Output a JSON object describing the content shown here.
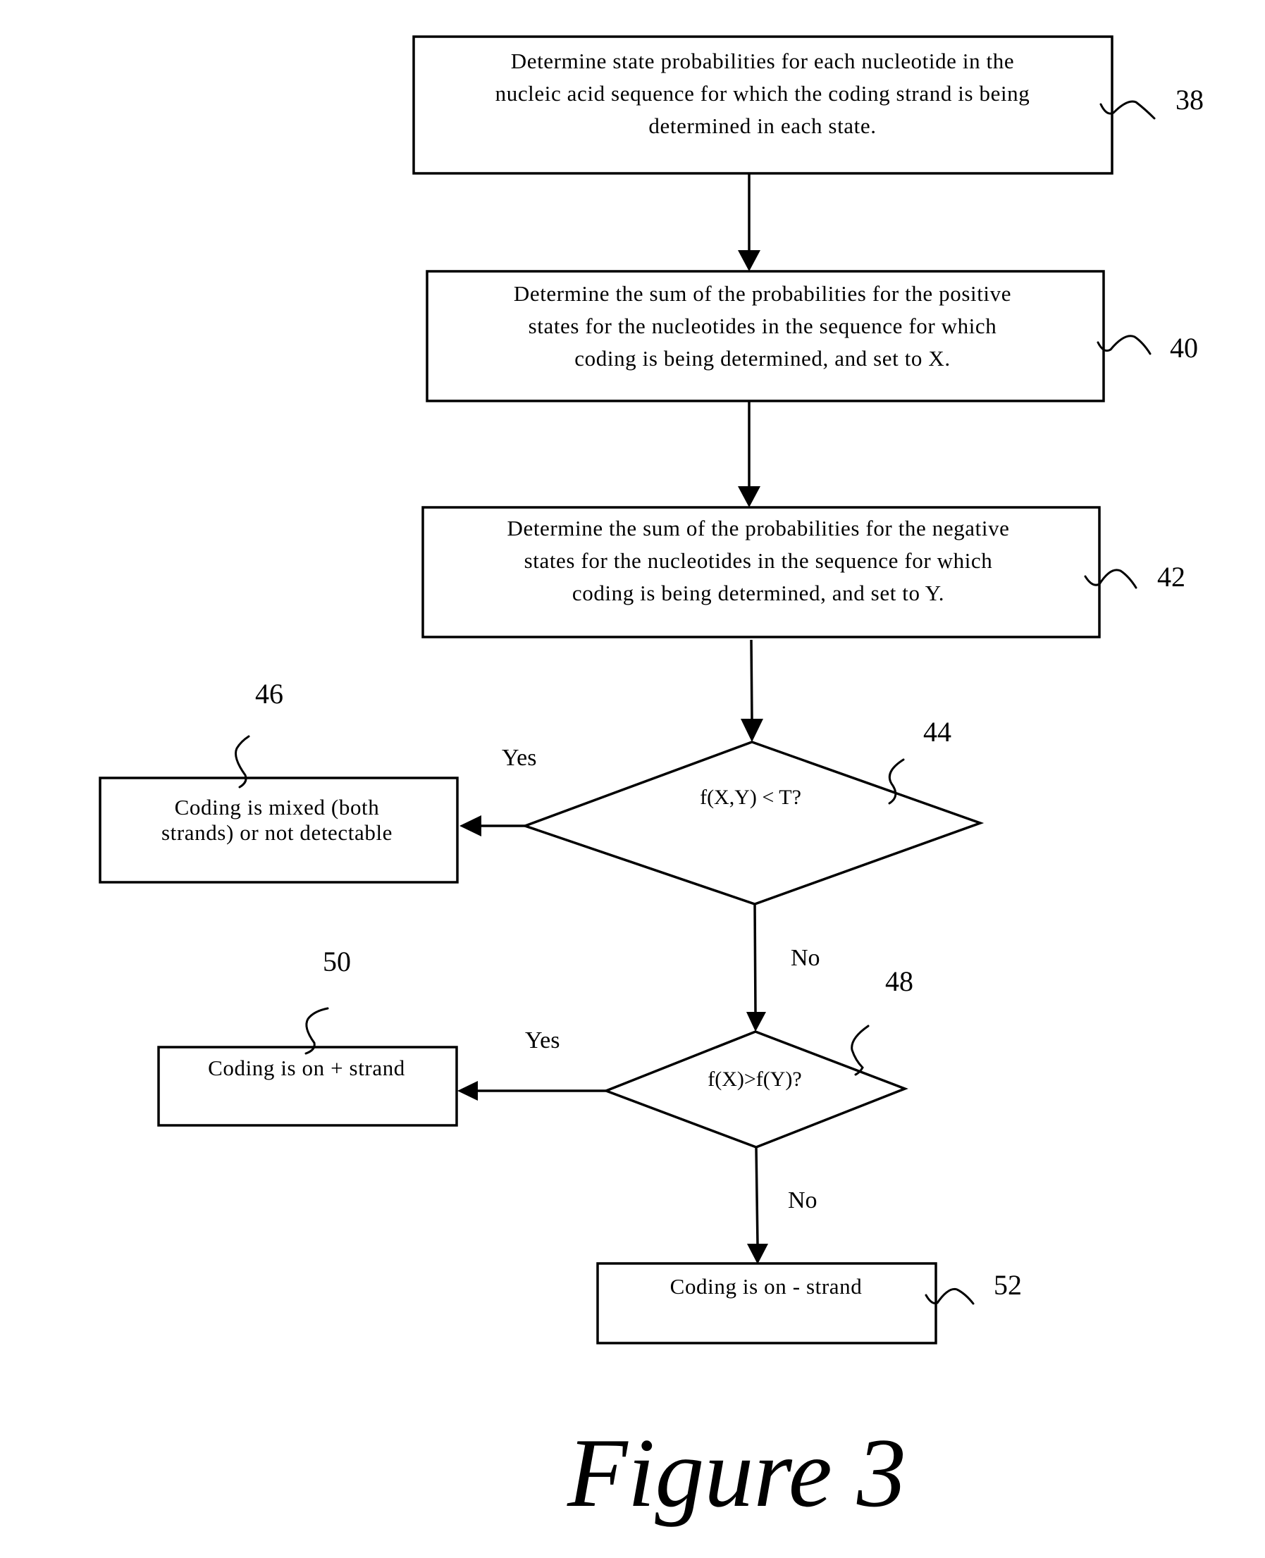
{
  "figure": {
    "caption": "Figure 3"
  },
  "steps": {
    "step38": {
      "ref": "38",
      "lines": [
        "Determine state probabilities for each nucleotide in the",
        "nucleic acid sequence for which the coding strand is being",
        "determined in each state."
      ]
    },
    "step40": {
      "ref": "40",
      "lines": [
        "Determine the sum of the probabilities for the positive",
        "states for the nucleotides in the sequence for which",
        "coding is being determined, and set to X."
      ]
    },
    "step42": {
      "ref": "42",
      "lines": [
        "Determine the sum of the probabilities for the negative",
        "states for the nucleotides in the sequence for which",
        "coding is being determined, and set to Y."
      ]
    },
    "decision44": {
      "ref": "44",
      "text": "f(X,Y) < T?",
      "yes_label": "Yes",
      "no_label": "No"
    },
    "result46": {
      "ref": "46",
      "lines": [
        "Coding is mixed (both",
        "strands) or not detectable"
      ]
    },
    "decision48": {
      "ref": "48",
      "text": "f(X)>f(Y)?",
      "yes_label": "Yes",
      "no_label": "No"
    },
    "result50": {
      "ref": "50",
      "lines": [
        "Coding is on + strand"
      ]
    },
    "result52": {
      "ref": "52",
      "lines": [
        "Coding is on - strand"
      ]
    }
  }
}
